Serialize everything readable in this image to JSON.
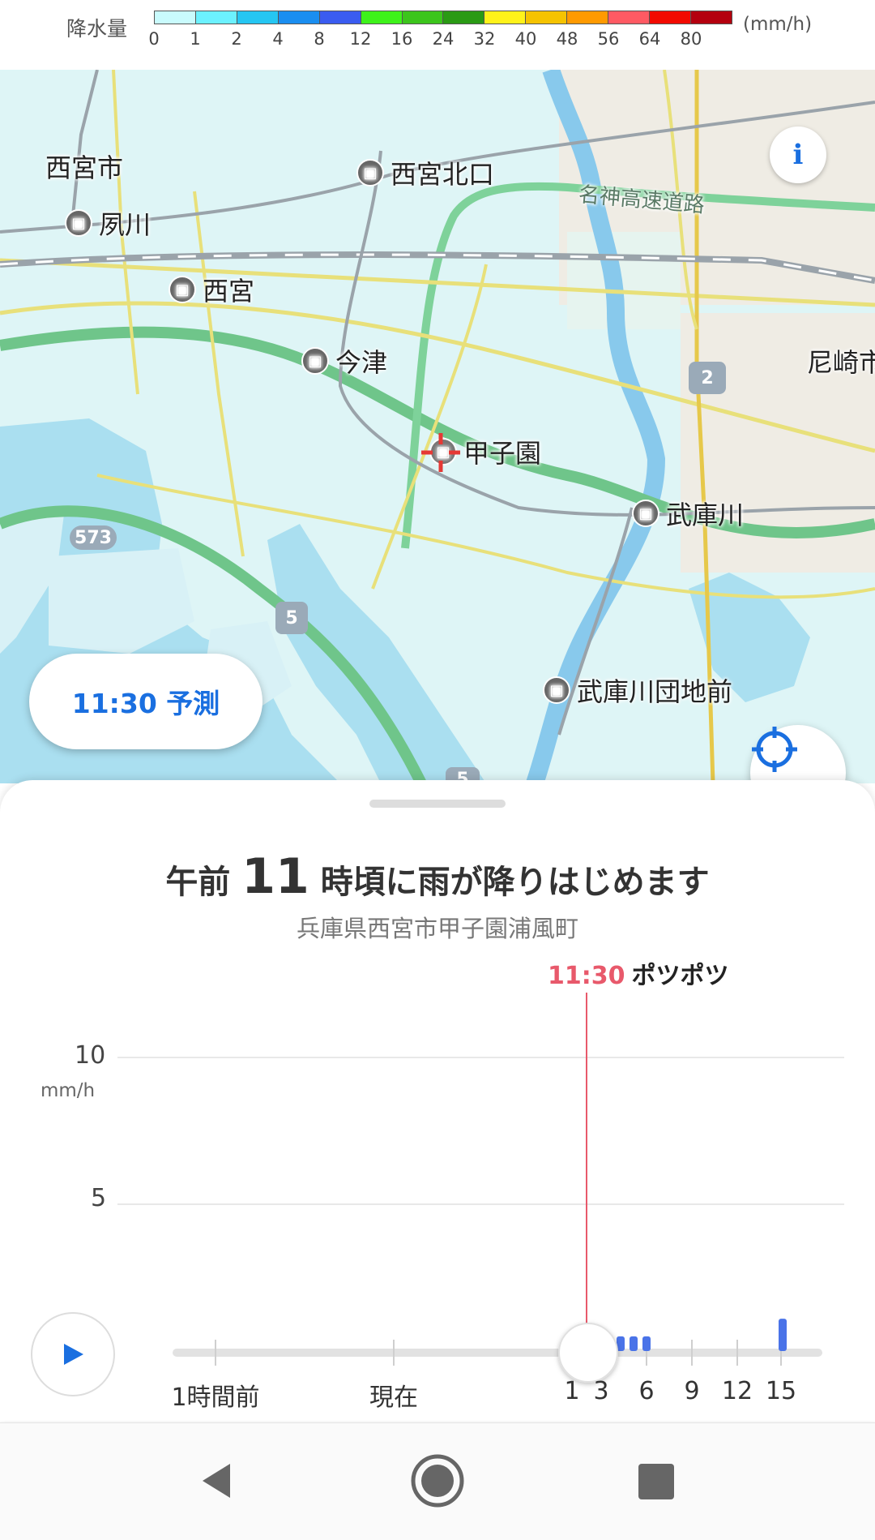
{
  "legend": {
    "title": "降水量",
    "unit": "(mm/h)",
    "ticks": [
      "0",
      "1",
      "2",
      "4",
      "8",
      "12",
      "16",
      "24",
      "32",
      "40",
      "48",
      "56",
      "64",
      "80"
    ],
    "colors": [
      "#c9fbfd",
      "#6cf1ff",
      "#25c6f2",
      "#1a8ef0",
      "#3a5cf0",
      "#3ef21a",
      "#3cc51c",
      "#2a9a14",
      "#fff21a",
      "#f5c300",
      "#ff9a00",
      "#ff5a63",
      "#f20a00",
      "#b4000f"
    ]
  },
  "map": {
    "places": {
      "nishinomiya_city": "西宮市",
      "amagasaki_city": "尼崎市",
      "expressway": "名神高速道路"
    },
    "stations": {
      "nishinomiya_kitaguchi": "西宮北口",
      "shukugawa": "夙川",
      "nishinomiya": "西宮",
      "imazu": "今津",
      "koshien": "甲子園",
      "mukogawa": "武庫川",
      "mukogawa_danchimae": "武庫川団地前"
    },
    "routes": {
      "r573": "573",
      "r2": "2",
      "r5": "5",
      "r5b": "5"
    },
    "info_icon": "i",
    "forecast_label": "11:30 予測"
  },
  "sheet": {
    "headline_prefix": "午前",
    "headline_hour": "11",
    "headline_suffix": "時頃に雨が降りはじめます",
    "address": "兵庫県西宮市甲子園浦風町",
    "marker_time": "11:30",
    "marker_desc": "ポツポツ"
  },
  "chart_data": {
    "type": "bar",
    "yunit": "mm/h",
    "ytick_labels": [
      "10",
      "5"
    ],
    "ylim": [
      0,
      10
    ],
    "xtick_labels": [
      "1時間前",
      "現在",
      "1",
      "3",
      "6",
      "9",
      "12",
      "15"
    ],
    "x_minutes": [
      0,
      1.0,
      1.5,
      2.0,
      3.0,
      4.5,
      5.0
    ],
    "values": [
      0,
      0,
      0,
      0,
      0,
      0,
      0
    ],
    "bars": [
      {
        "t": 11.45,
        "v": 0.5
      },
      {
        "t": 11.5,
        "v": 0.5
      },
      {
        "t": 11.55,
        "v": 0.5
      },
      {
        "t": 12.0,
        "v": 1.1
      }
    ],
    "selected_time": "11:30",
    "bar_color": "#4a73e8",
    "marker_color": "#e8596b"
  },
  "nav": {
    "back": "back-icon",
    "home": "home-icon",
    "recents": "recents-icon"
  }
}
